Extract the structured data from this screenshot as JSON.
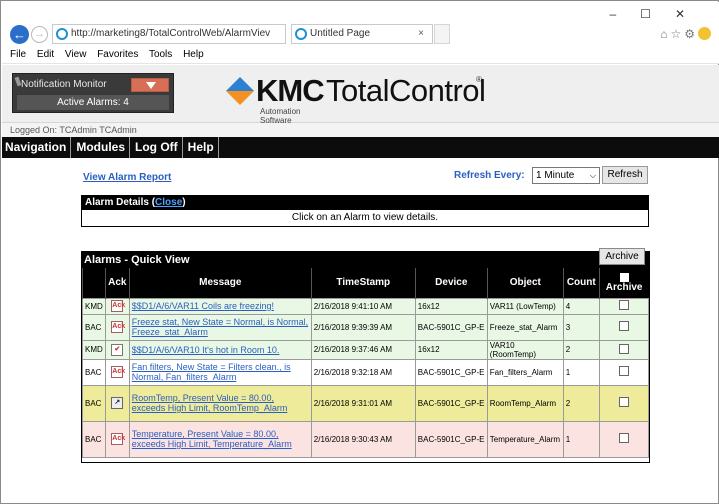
{
  "browser": {
    "url": "http://marketing8/TotalControlWeb/AlarmViev",
    "tab_title": "Untitled Page",
    "menu": [
      "File",
      "Edit",
      "View",
      "Favorites",
      "Tools",
      "Help"
    ]
  },
  "header": {
    "notif_title": "Notification Monitor",
    "active_alarms": "Active Alarms: 4",
    "logo_kmc": "KMC",
    "logo_tc": "TotalControl",
    "logo_reg": "®",
    "logo_sub": "Automation Software"
  },
  "logged_on": "Logged On: TCAdmin TCAdmin",
  "nav": [
    "Navigation",
    "Modules",
    "Log Off",
    "Help"
  ],
  "toolbar": {
    "view_report": "View Alarm Report",
    "refresh_label": "Refresh Every:",
    "refresh_value": "1 Minute",
    "refresh_button": "Refresh"
  },
  "details": {
    "title": "Alarm Details (",
    "close": "Close",
    "title_end": ")",
    "message": "Click on an Alarm to view details."
  },
  "alarms": {
    "title": "Alarms - Quick View",
    "archive_button": "Archive",
    "columns": [
      "",
      "Ack",
      "Message",
      "TimeStamp",
      "Device",
      "Object",
      "Count",
      "Archive"
    ],
    "rows": [
      {
        "src": "KMD",
        "ack": "unacked",
        "message": "$$D1/A/6/VAR11 Coils are freezing!",
        "timestamp": "2/16/2018 9:41:10 AM",
        "device": "16x12",
        "object": "VAR11 (LowTemp)",
        "count": "4",
        "color": "green"
      },
      {
        "src": "BAC",
        "ack": "unacked",
        "message": "Freeze stat, New  State = Normal, is Normal, Freeze_stat_Alarm",
        "timestamp": "2/16/2018 9:39:39 AM",
        "device": "BAC-5901C_GP-E",
        "object": "Freeze_stat_Alarm",
        "count": "3",
        "color": "green"
      },
      {
        "src": "KMD",
        "ack": "done",
        "message": "$$D1/A/6/VAR10 It's hot in Room 10.",
        "timestamp": "2/16/2018 9:37:46 AM",
        "device": "16x12",
        "object": "VAR10 (RoomTemp)",
        "count": "2",
        "color": "green"
      },
      {
        "src": "BAC",
        "ack": "unacked",
        "message": "Fan filters, New  State = Filters clean., is Normal, Fan_filters_Alarm",
        "timestamp": "2/16/2018 9:32:18 AM",
        "device": "BAC-5901C_GP-E",
        "object": "Fan_filters_Alarm",
        "count": "1",
        "color": "white"
      },
      {
        "src": "BAC",
        "ack": "acked",
        "message": "RoomTemp, Present  Value = 80.00, exceeds High  Limit, RoomTemp_Alarm",
        "timestamp": "2/16/2018 9:31:01 AM",
        "device": "BAC-5901C_GP-E",
        "object": "RoomTemp_Alarm",
        "count": "2",
        "color": "yellow"
      },
      {
        "src": "BAC",
        "ack": "unacked",
        "message": "Temperature, Present  Value = 80.00, exceeds High  Limit, Temperature_Alarm",
        "timestamp": "2/16/2018 9:30:43 AM",
        "device": "BAC-5901C_GP-E",
        "object": "Temperature_Alarm",
        "count": "1",
        "color": "pink"
      }
    ]
  }
}
